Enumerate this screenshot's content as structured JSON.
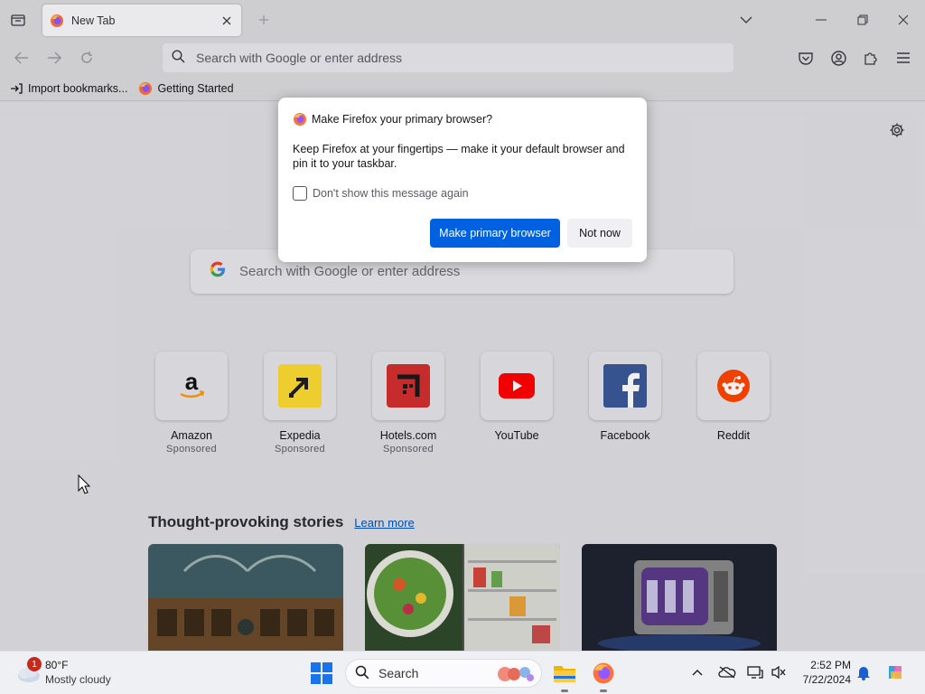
{
  "tab": {
    "title": "New Tab"
  },
  "urlbar": {
    "placeholder": "Search with Google or enter address"
  },
  "bookmarks": [
    {
      "label": "Import bookmarks..."
    },
    {
      "label": "Getting Started"
    }
  ],
  "new_tab_search": {
    "placeholder": "Search with Google or enter address"
  },
  "top_sites": [
    {
      "name": "Amazon",
      "sponsored": "Sponsored"
    },
    {
      "name": "Expedia",
      "sponsored": "Sponsored"
    },
    {
      "name": "Hotels.com",
      "sponsored": "Sponsored"
    },
    {
      "name": "YouTube",
      "sponsored": ""
    },
    {
      "name": "Facebook",
      "sponsored": ""
    },
    {
      "name": "Reddit",
      "sponsored": ""
    }
  ],
  "stories": {
    "heading": "Thought-provoking stories",
    "learn_more": "Learn more"
  },
  "dialog": {
    "title": "Make Firefox your primary browser?",
    "body": "Keep Firefox at your fingertips — make it your default browser and pin it to your taskbar.",
    "checkbox_label": "Don't show this message again",
    "primary_button": "Make primary browser",
    "secondary_button": "Not now"
  },
  "taskbar": {
    "weather_badge": "1",
    "temperature": "80°F",
    "condition": "Mostly cloudy",
    "search_label": "Search",
    "time": "2:52 PM",
    "date": "7/22/2024"
  },
  "colors": {
    "accent": "#0061e0",
    "youtube": "#ff0000",
    "facebook": "#1877f2",
    "reddit": "#ff4500",
    "expedia": "#fddb32",
    "hotels": "#d32f2f"
  }
}
